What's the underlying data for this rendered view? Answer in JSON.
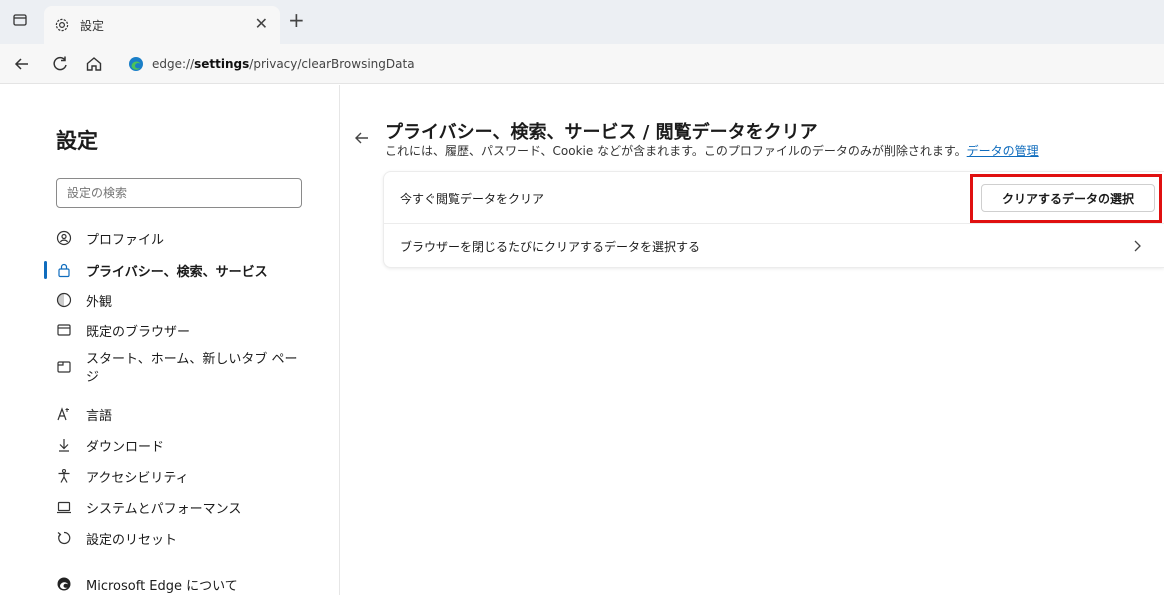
{
  "browser": {
    "tab_title": "設定",
    "url_prefix": "edge://",
    "url_bold": "settings",
    "url_suffix": "/privacy/clearBrowsingData"
  },
  "sidebar": {
    "title": "設定",
    "search_placeholder": "設定の検索",
    "items": [
      {
        "label": "プロファイル",
        "icon": "profile-icon"
      },
      {
        "label": "プライバシー、検索、サービス",
        "icon": "lock-icon",
        "active": true
      },
      {
        "label": "外観",
        "icon": "appearance-icon"
      },
      {
        "label": "既定のブラウザー",
        "icon": "browser-icon"
      },
      {
        "label": "スタート、ホーム、新しいタブ ページ",
        "icon": "home-tab-icon"
      },
      {
        "label": "言語",
        "icon": "language-icon"
      },
      {
        "label": "ダウンロード",
        "icon": "download-icon"
      },
      {
        "label": "アクセシビリティ",
        "icon": "accessibility-icon"
      },
      {
        "label": "システムとパフォーマンス",
        "icon": "system-icon"
      },
      {
        "label": "設定のリセット",
        "icon": "reset-icon"
      },
      {
        "label": "Microsoft Edge について",
        "icon": "edge-icon"
      }
    ]
  },
  "main": {
    "title": "プライバシー、検索、サービス / 閲覧データをクリア",
    "description": "これには、履歴、パスワード、Cookie などが含まれます。このプロファイルのデータのみが削除されます。",
    "manage_link": "データの管理",
    "row1_label": "今すぐ閲覧データをクリア",
    "choose_button": "クリアするデータの選択",
    "row2_label": "ブラウザーを閉じるたびにクリアするデータを選択する"
  },
  "colors": {
    "accent": "#0f6cbd",
    "highlight": "#e01010"
  }
}
